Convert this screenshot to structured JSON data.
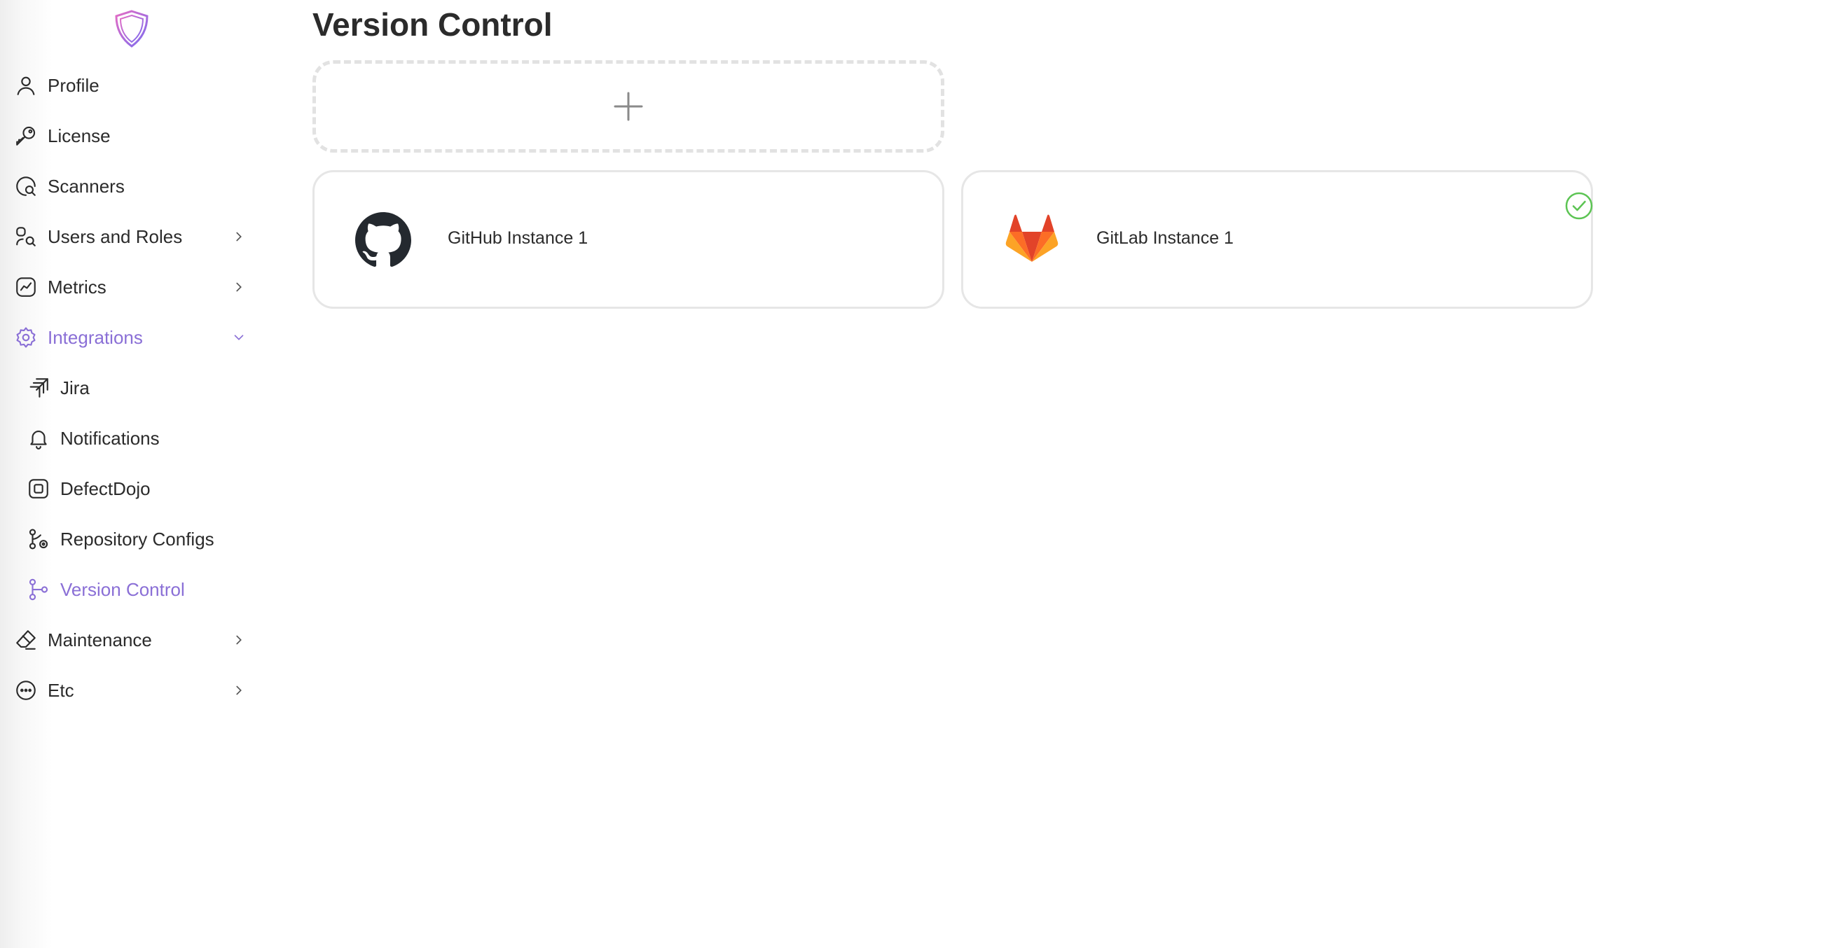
{
  "sidebar": {
    "items": [
      {
        "label": "Profile"
      },
      {
        "label": "License"
      },
      {
        "label": "Scanners"
      },
      {
        "label": "Users and Roles"
      },
      {
        "label": "Metrics"
      },
      {
        "label": "Integrations"
      },
      {
        "label": "Jira"
      },
      {
        "label": "Notifications"
      },
      {
        "label": "DefectDojo"
      },
      {
        "label": "Repository Configs"
      },
      {
        "label": "Version Control"
      },
      {
        "label": "Maintenance"
      },
      {
        "label": "Etc"
      }
    ],
    "active_item": "Version Control",
    "expanded_group": "Integrations"
  },
  "main": {
    "title": "Version Control",
    "cards": [
      {
        "label": "GitHub Instance 1",
        "icon": "github-icon",
        "selected": false
      },
      {
        "label": "GitLab Instance 1",
        "icon": "gitlab-icon",
        "selected": true
      }
    ]
  },
  "colors": {
    "accent": "#8a6fd6",
    "text": "#2b2b2b",
    "success": "#5cc453",
    "card_border": "#e6e6e6"
  }
}
